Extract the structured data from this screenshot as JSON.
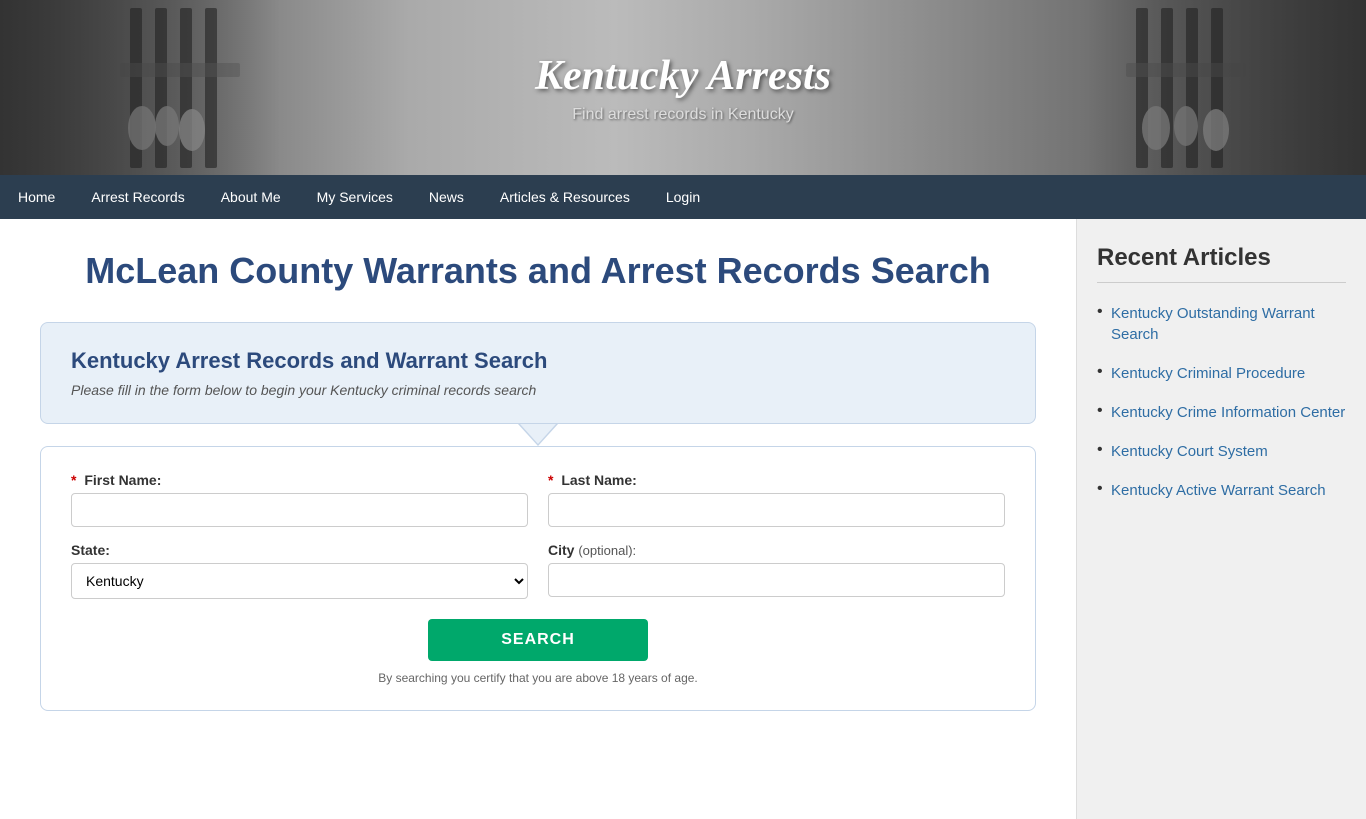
{
  "header": {
    "title": "Kentucky Arrests",
    "subtitle": "Find arrest records in Kentucky"
  },
  "nav": {
    "items": [
      {
        "label": "Home",
        "active": false
      },
      {
        "label": "Arrest Records",
        "active": false
      },
      {
        "label": "About Me",
        "active": false
      },
      {
        "label": "My Services",
        "active": false
      },
      {
        "label": "News",
        "active": false
      },
      {
        "label": "Articles & Resources",
        "active": false
      },
      {
        "label": "Login",
        "active": false
      }
    ]
  },
  "main": {
    "page_title": "McLean County Warrants and Arrest Records Search",
    "search_box": {
      "title": "Kentucky Arrest Records and Warrant Search",
      "subtitle": "Please fill in the form below to begin your Kentucky criminal records search"
    },
    "form": {
      "first_name_label": "First Name:",
      "last_name_label": "Last Name:",
      "state_label": "State:",
      "city_label": "City",
      "city_optional": "(optional):",
      "state_default": "Kentucky",
      "search_button": "SEARCH",
      "disclaimer": "By searching you certify that you are above 18 years of age."
    }
  },
  "sidebar": {
    "title": "Recent Articles",
    "articles": [
      {
        "label": "Kentucky Outstanding Warrant Search"
      },
      {
        "label": "Kentucky Criminal Procedure"
      },
      {
        "label": "Kentucky Crime Information Center"
      },
      {
        "label": "Kentucky Court System"
      },
      {
        "label": "Kentucky Active Warrant Search"
      }
    ]
  }
}
